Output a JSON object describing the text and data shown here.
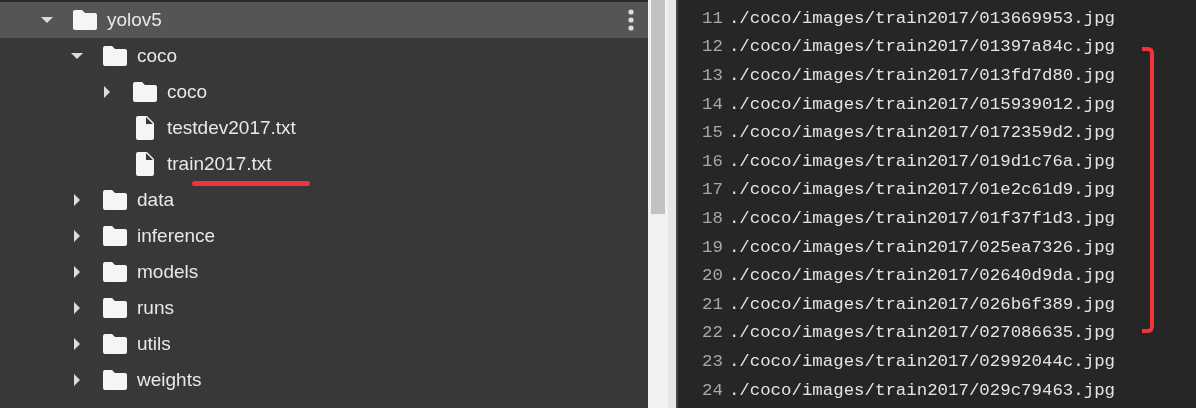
{
  "file_tree": [
    {
      "name": "yolov5",
      "kind": "folder",
      "expanded": true,
      "selected": true,
      "underlined": false,
      "children": [
        {
          "name": "coco",
          "kind": "folder",
          "expanded": true,
          "selected": false,
          "underlined": false,
          "children": [
            {
              "name": "coco",
              "kind": "folder",
              "expanded": false,
              "selected": false,
              "underlined": false
            },
            {
              "name": "testdev2017.txt",
              "kind": "file",
              "selected": false,
              "underlined": false
            },
            {
              "name": "train2017.txt",
              "kind": "file",
              "selected": false,
              "underlined": true
            }
          ]
        },
        {
          "name": "data",
          "kind": "folder",
          "expanded": false,
          "selected": false,
          "underlined": false
        },
        {
          "name": "inference",
          "kind": "folder",
          "expanded": false,
          "selected": false,
          "underlined": false
        },
        {
          "name": "models",
          "kind": "folder",
          "expanded": false,
          "selected": false,
          "underlined": false
        },
        {
          "name": "runs",
          "kind": "folder",
          "expanded": false,
          "selected": false,
          "underlined": false
        },
        {
          "name": "utils",
          "kind": "folder",
          "expanded": false,
          "selected": false,
          "underlined": false
        },
        {
          "name": "weights",
          "kind": "folder",
          "expanded": false,
          "selected": false,
          "underlined": false
        }
      ]
    }
  ],
  "editor": {
    "lines": [
      {
        "number": "11",
        "text": "./coco/images/train2017/013669953.jpg",
        "marked": false
      },
      {
        "number": "12",
        "text": "./coco/images/train2017/01397a84c.jpg",
        "marked": true
      },
      {
        "number": "13",
        "text": "./coco/images/train2017/013fd7d80.jpg",
        "marked": true
      },
      {
        "number": "14",
        "text": "./coco/images/train2017/015939012.jpg",
        "marked": true
      },
      {
        "number": "15",
        "text": "./coco/images/train2017/0172359d2.jpg",
        "marked": true
      },
      {
        "number": "16",
        "text": "./coco/images/train2017/019d1c76a.jpg",
        "marked": true
      },
      {
        "number": "17",
        "text": "./coco/images/train2017/01e2c61d9.jpg",
        "marked": true
      },
      {
        "number": "18",
        "text": "./coco/images/train2017/01f37f1d3.jpg",
        "marked": true
      },
      {
        "number": "19",
        "text": "./coco/images/train2017/025ea7326.jpg",
        "marked": true
      },
      {
        "number": "20",
        "text": "./coco/images/train2017/02640d9da.jpg",
        "marked": true
      },
      {
        "number": "21",
        "text": "./coco/images/train2017/026b6f389.jpg",
        "marked": true
      },
      {
        "number": "22",
        "text": "./coco/images/train2017/027086635.jpg",
        "marked": true
      },
      {
        "number": "23",
        "text": "./coco/images/train2017/02992044c.jpg",
        "marked": false
      },
      {
        "number": "24",
        "text": "./coco/images/train2017/029c79463.jpg",
        "marked": false
      }
    ]
  }
}
